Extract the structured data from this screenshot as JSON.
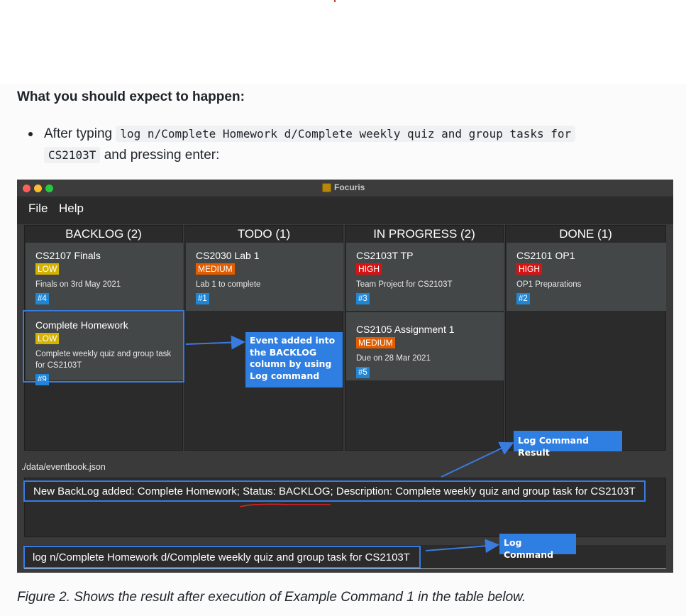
{
  "doc": {
    "heading": "What you should expect to happen:",
    "bullet_prefix": "After typing",
    "command_code": "log n/Complete Homework d/Complete weekly quiz and group tasks for",
    "command_code_cont": "CS2103T",
    "bullet_suffix": "and pressing enter:",
    "caption": "Figure 2. Shows the result after execution of Example Command 1 in the table below."
  },
  "app": {
    "title": "Focuris",
    "menu": [
      "File",
      "Help"
    ],
    "columns": [
      {
        "header": "BACKLOG (2)",
        "cards": [
          {
            "title": "CS2107 Finals",
            "priority": "LOW",
            "desc": "Finals on 3rd May 2021",
            "id": "#4"
          },
          {
            "title": "Complete Homework",
            "priority": "LOW",
            "desc": "Complete weekly quiz and group task for CS2103T",
            "id": "#9"
          }
        ]
      },
      {
        "header": "TODO (1)",
        "cards": [
          {
            "title": "CS2030 Lab 1",
            "priority": "MEDIUM",
            "desc": "Lab 1 to complete",
            "id": "#1"
          }
        ]
      },
      {
        "header": "IN PROGRESS (2)",
        "cards": [
          {
            "title": "CS2103T TP",
            "priority": "HIGH",
            "desc": "Team Project for CS2103T",
            "id": "#3"
          },
          {
            "title": "CS2105 Assignment 1",
            "priority": "MEDIUM",
            "desc": "Due on 28 Mar 2021",
            "id": "#5"
          }
        ]
      },
      {
        "header": "DONE (1)",
        "cards": [
          {
            "title": "CS2101 OP1",
            "priority": "HIGH",
            "desc": "OP1 Preparations",
            "id": "#2"
          }
        ]
      }
    ],
    "status_path": "./data/eventbook.json",
    "result_text": "New BackLog added: Complete Homework; Status: BACKLOG; Description: Complete weekly quiz and group task for CS2103T",
    "command_input": "log n/Complete Homework d/Complete weekly quiz and group task for CS2103T"
  },
  "annotations": {
    "event_added": [
      "Event added into",
      "the BACKLOG",
      "column by using",
      "Log command"
    ],
    "log_result": "Log Command Result",
    "log_command": "Log Command"
  },
  "colors": {
    "low": "#d4b200",
    "medium": "#e25c00",
    "high": "#d81313",
    "id_badge": "#1f86d6",
    "callout": "#2f7fe3"
  }
}
